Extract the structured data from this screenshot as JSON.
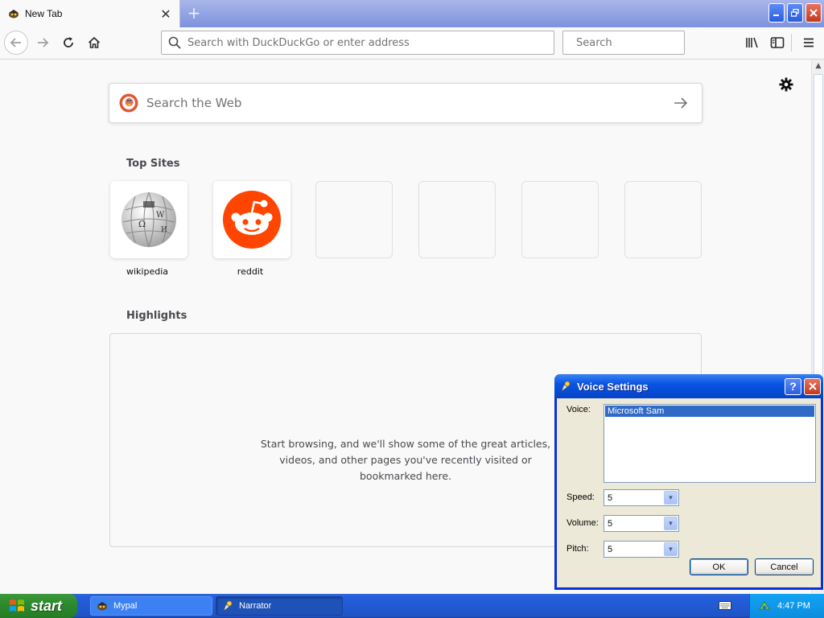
{
  "browser": {
    "tab_title": "New Tab",
    "url_placeholder": "Search with DuckDuckGo or enter address",
    "search_placeholder": "Search"
  },
  "newtab": {
    "web_search_placeholder": "Search the Web",
    "top_sites_title": "Top Sites",
    "top_sites": [
      {
        "label": "wikipedia",
        "icon": "wikipedia-globe-icon"
      },
      {
        "label": "reddit",
        "icon": "reddit-alien-icon"
      },
      {
        "label": ""
      },
      {
        "label": ""
      },
      {
        "label": ""
      },
      {
        "label": ""
      }
    ],
    "highlights_title": "Highlights",
    "highlights_empty_lines": [
      "Start browsing, and we'll show some of the great articles,",
      "videos, and other pages you've recently visited or",
      "bookmarked here."
    ]
  },
  "dialog": {
    "title": "Voice Settings",
    "help_label": "?",
    "voice_label": "Voice:",
    "voice_options": [
      "Microsoft Sam"
    ],
    "speed_label": "Speed:",
    "speed_value": "5",
    "volume_label": "Volume:",
    "volume_value": "5",
    "pitch_label": "Pitch:",
    "pitch_value": "5",
    "ok_label": "OK",
    "cancel_label": "Cancel"
  },
  "taskbar": {
    "start_label": "start",
    "tasks": [
      {
        "label": "Mypal",
        "active": false
      },
      {
        "label": "Narrator",
        "active": true
      }
    ],
    "clock": "4:47 PM"
  },
  "colors": {
    "reddit": "#ff4500",
    "xp_titlebar": "#0a54e3",
    "start_green": "#2d8b2d",
    "selection": "#316ac5"
  }
}
